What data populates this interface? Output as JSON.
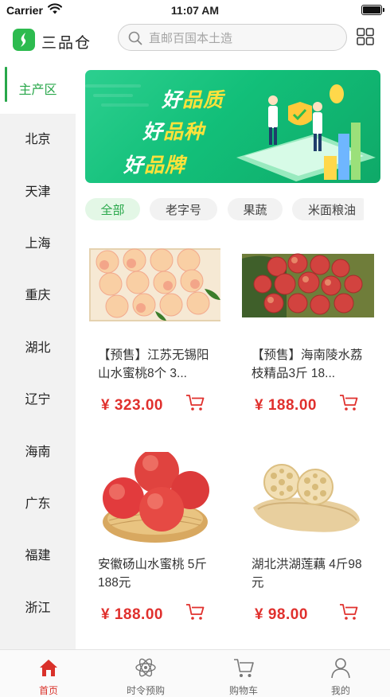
{
  "status_bar": {
    "carrier": "Carrier",
    "time": "11:07 AM"
  },
  "header": {
    "app_name": "三品仓",
    "search_placeholder": "直邮百国本土造"
  },
  "sidebar": {
    "items": [
      "主产区",
      "北京",
      "天津",
      "上海",
      "重庆",
      "湖北",
      "辽宁",
      "海南",
      "广东",
      "福建",
      "浙江"
    ],
    "active_index": 0
  },
  "banner": {
    "lines": [
      {
        "prefix": "好",
        "highlight": "品质"
      },
      {
        "prefix": "好",
        "highlight": "品种"
      },
      {
        "prefix": "好",
        "highlight": "品牌"
      }
    ]
  },
  "category_tabs": {
    "items": [
      "全部",
      "老字号",
      "果蔬",
      "米面粮油"
    ],
    "active_index": 0
  },
  "products": [
    {
      "name": "【预售】江苏无锡阳山水蜜桃8个 3...",
      "price": "¥ 323.00"
    },
    {
      "name": "【预售】海南陵水荔枝精品3斤 18...",
      "price": "¥ 188.00"
    },
    {
      "name": "安徽砀山水蜜桃 5斤 188元",
      "price": "¥ 188.00"
    },
    {
      "name": "湖北洪湖莲藕 4斤98元",
      "price": "¥ 98.00"
    }
  ],
  "tab_bar": {
    "items": [
      {
        "label": "首页",
        "icon": "home-icon"
      },
      {
        "label": "时令预购",
        "icon": "atom-icon"
      },
      {
        "label": "购物车",
        "icon": "cart-icon"
      },
      {
        "label": "我的",
        "icon": "user-icon"
      }
    ],
    "active_index": 0
  },
  "colors": {
    "brand": "#28a74a",
    "price": "#e0302d",
    "active_tab": "#d9312a"
  }
}
